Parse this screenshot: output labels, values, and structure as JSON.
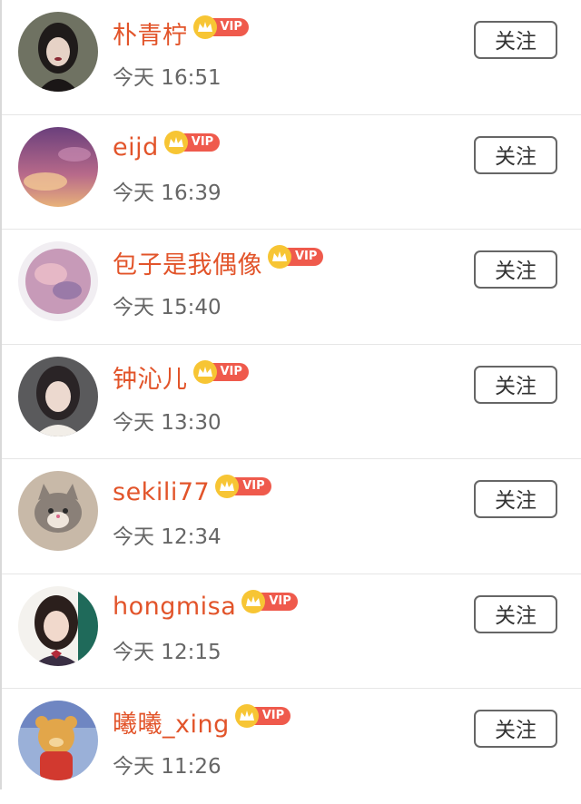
{
  "follow_label": "关注",
  "vip_label": "VIP",
  "colors": {
    "name": "#e2542a",
    "vip_pill": "#ef5a4c",
    "vip_crown": "#f7c534",
    "time": "#666666"
  },
  "users": [
    {
      "name": "朴青柠",
      "time": "今天 16:51",
      "avatar_icon": "portrait-avatar"
    },
    {
      "name": "eijd",
      "time": "今天 16:39",
      "avatar_icon": "purple-sky-avatar"
    },
    {
      "name": "包子是我偶像",
      "time": "今天 15:40",
      "avatar_icon": "pink-cloud-avatar"
    },
    {
      "name": "钟沁儿",
      "time": "今天 13:30",
      "avatar_icon": "portrait-avatar"
    },
    {
      "name": "sekili77",
      "time": "今天 12:34",
      "avatar_icon": "cat-avatar"
    },
    {
      "name": "hongmisa",
      "time": "今天 12:15",
      "avatar_icon": "portrait-avatar"
    },
    {
      "name": "曦曦_xing",
      "time": "今天 11:26",
      "avatar_icon": "bear-avatar"
    }
  ]
}
